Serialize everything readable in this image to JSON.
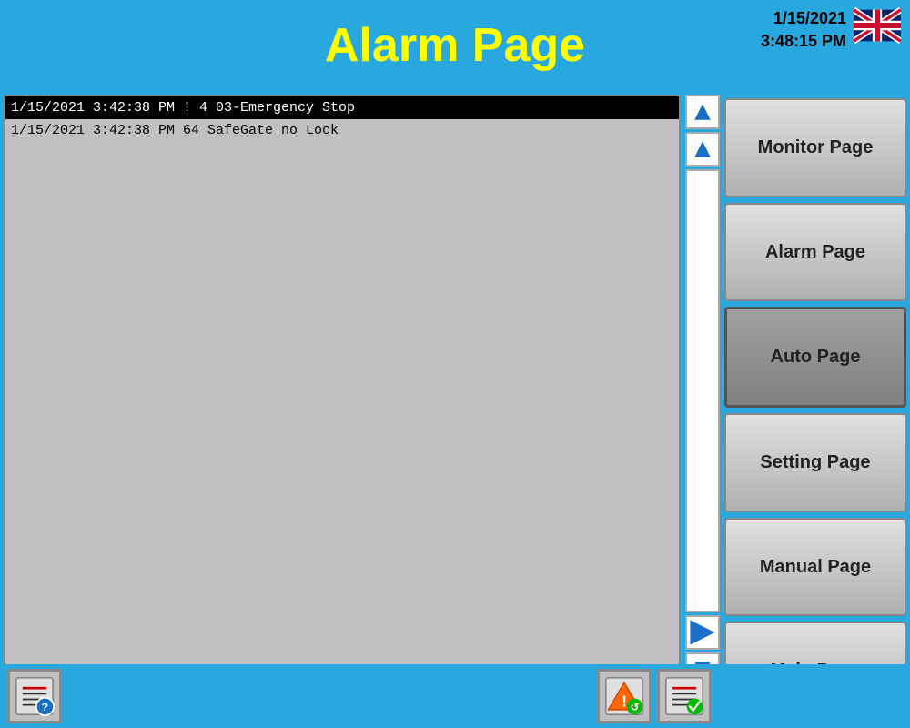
{
  "header": {
    "title": "Alarm Page",
    "date": "1/15/2021",
    "time": "3:48:15 PM"
  },
  "alarms": [
    {
      "text": "1/15/2021 3:42:38 PM ! 4 03-Emergency Stop",
      "selected": true
    },
    {
      "text": "1/15/2021 3:42:38 PM  64 SafeGate no Lock",
      "selected": false
    }
  ],
  "nav_buttons": [
    {
      "label": "Monitor Page",
      "active": false
    },
    {
      "label": "Alarm Page",
      "active": false
    },
    {
      "label": "Auto Page",
      "active": true
    },
    {
      "label": "Setting Page",
      "active": false
    },
    {
      "label": "Manual Page",
      "active": false
    },
    {
      "label": "Main Page",
      "active": false
    }
  ],
  "scroll_arrows": {
    "up_top": "▲",
    "up": "▲",
    "right": "▶",
    "down": "▼",
    "down_bottom": "▼"
  },
  "bottom_buttons": {
    "help_label": "help-icon",
    "warning_label": "warning-icon",
    "checklist_label": "checklist-icon"
  },
  "colors": {
    "background": "#29a8e0",
    "title_yellow": "#ffff00",
    "button_bg": "#c8c8c8",
    "selected_row": "#000000"
  }
}
